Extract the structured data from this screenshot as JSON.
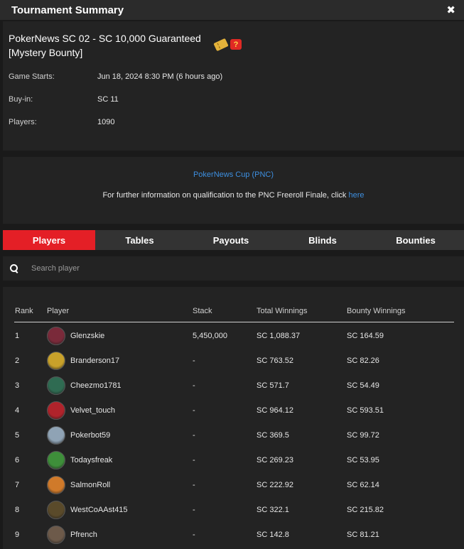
{
  "window": {
    "title": "Tournament Summary",
    "close_label": "✖"
  },
  "tournament": {
    "name_line1": "PokerNews SC 02 - SC 10,000 Guaranteed",
    "name_line2": "[Mystery Bounty]",
    "icons": [
      "ticket-icon",
      "mystery-gift-icon"
    ],
    "gift_symbol": "?",
    "details": [
      {
        "label": "Game Starts:",
        "value": "Jun 18, 2024 8:30 PM (6 hours ago)"
      },
      {
        "label": "Buy-in:",
        "value": "SC 11"
      },
      {
        "label": "Players:",
        "value": "1090"
      }
    ]
  },
  "pnc": {
    "link_label": "PokerNews Cup (PNC)",
    "info_text": "For further information on qualification to the PNC Freeroll Finale, click ",
    "info_link": "here"
  },
  "tabs": [
    {
      "label": "Players",
      "active": true
    },
    {
      "label": "Tables",
      "active": false
    },
    {
      "label": "Payouts",
      "active": false
    },
    {
      "label": "Blinds",
      "active": false
    },
    {
      "label": "Bounties",
      "active": false
    }
  ],
  "search": {
    "placeholder": "Search player"
  },
  "table": {
    "headers": {
      "rank": "Rank",
      "player": "Player",
      "stack": "Stack",
      "total": "Total Winnings",
      "bounty": "Bounty Winnings"
    },
    "rows": [
      {
        "rank": "1",
        "player": "Glenzskie",
        "stack": "5,450,000",
        "total": "SC 1,088.37",
        "bounty": "SC 164.59",
        "avatar_color": "#7a2a3a"
      },
      {
        "rank": "2",
        "player": "Branderson17",
        "stack": "-",
        "total": "SC 763.52",
        "bounty": "SC 82.26",
        "avatar_color": "#c8a12a"
      },
      {
        "rank": "3",
        "player": "Cheezmo1781",
        "stack": "-",
        "total": "SC 571.7",
        "bounty": "SC 54.49",
        "avatar_color": "#2f6b52"
      },
      {
        "rank": "4",
        "player": "Velvet_touch",
        "stack": "-",
        "total": "SC 964.12",
        "bounty": "SC 593.51",
        "avatar_color": "#b0232b"
      },
      {
        "rank": "5",
        "player": "Pokerbot59",
        "stack": "-",
        "total": "SC 369.5",
        "bounty": "SC 99.72",
        "avatar_color": "#8fa3b5"
      },
      {
        "rank": "6",
        "player": "Todaysfreak",
        "stack": "-",
        "total": "SC 269.23",
        "bounty": "SC 53.95",
        "avatar_color": "#3e8f3a"
      },
      {
        "rank": "7",
        "player": "SalmonRoll",
        "stack": "-",
        "total": "SC 222.92",
        "bounty": "SC 62.14",
        "avatar_color": "#d07a2a"
      },
      {
        "rank": "8",
        "player": "WestCoAAst415",
        "stack": "-",
        "total": "SC 322.1",
        "bounty": "SC 215.82",
        "avatar_color": "#5a4a2a"
      },
      {
        "rank": "9",
        "player": "Pfrench",
        "stack": "-",
        "total": "SC 142.8",
        "bounty": "SC 81.21",
        "avatar_color": "#6d5a4a"
      }
    ]
  },
  "colors": {
    "accent": "#e41f26",
    "link": "#3d8fe0",
    "panel": "#232323",
    "background": "#1a1a1a"
  }
}
